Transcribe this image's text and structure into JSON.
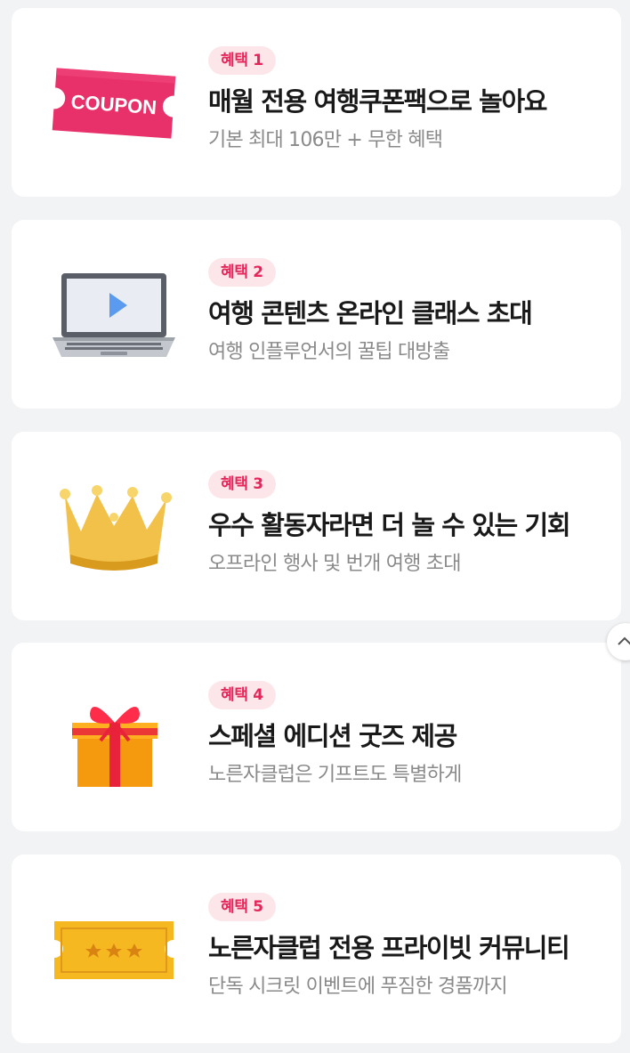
{
  "benefits": [
    {
      "badge": "혜택 1",
      "title": "매월 전용 여행쿠폰팩으로 놀아요",
      "subtitle": "기본 최대 106만 + 무한 혜택",
      "icon": "coupon-icon",
      "icon_text": "COUPON"
    },
    {
      "badge": "혜택 2",
      "title": "여행 콘텐츠 온라인 클래스 초대",
      "subtitle": "여행 인플루언서의 꿀팁 대방출",
      "icon": "laptop-play-icon"
    },
    {
      "badge": "혜택 3",
      "title": "우수 활동자라면 더 놀 수 있는 기회",
      "subtitle": "오프라인 행사 및 번개 여행 초대",
      "icon": "crown-icon"
    },
    {
      "badge": "혜택 4",
      "title": "스페셜 에디션 굿즈 제공",
      "subtitle": "노른자클럽은 기프트도 특별하게",
      "icon": "gift-box-icon"
    },
    {
      "badge": "혜택 5",
      "title": "노른자클럽 전용 프라이빗 커뮤니티",
      "subtitle": "단독 시크릿 이벤트에 푸짐한 경품까지",
      "icon": "golden-ticket-icon"
    }
  ],
  "colors": {
    "badge_bg": "#fde6ea",
    "badge_text": "#e5265a",
    "coupon": "#e8306a",
    "gold": "#f5b821",
    "background": "#f2f3f5"
  },
  "scroll_top": {
    "icon": "chevron-up-icon"
  }
}
